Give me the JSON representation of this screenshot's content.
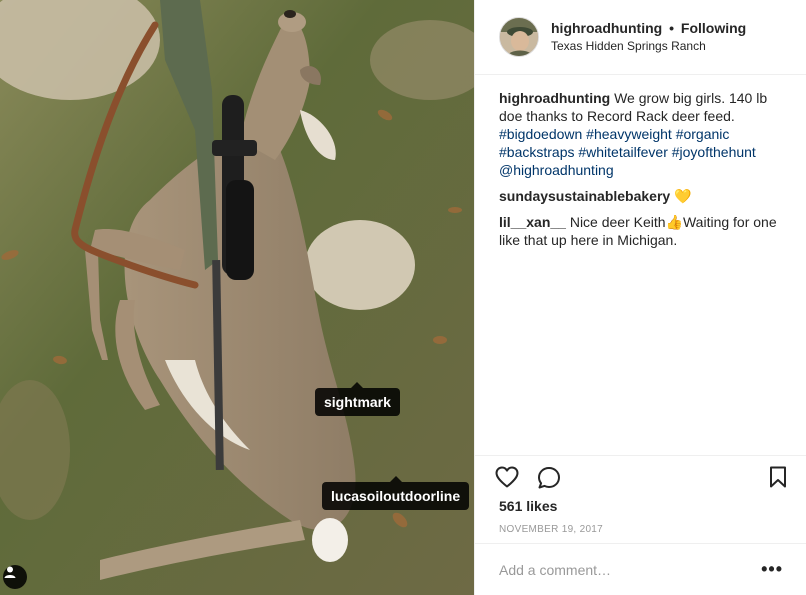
{
  "post": {
    "tags": {
      "sightmark": "sightmark",
      "lucas": "lucasoiloutdoorline"
    }
  },
  "header": {
    "username": "highroadhunting",
    "separator": "•",
    "follow_status": "Following",
    "location": "Texas Hidden Springs Ranch"
  },
  "caption": {
    "username": "highroadhunting",
    "text": "We grow big girls. 140 lb doe thanks to Record Rack deer feed.",
    "hashtags": "#bigdoedown #heavyweight #organic #backstraps #whitetailfever #joyofthehunt",
    "mention": "@highroadhunting"
  },
  "comments": [
    {
      "username": "sundaysustainablebakery",
      "text": "💛"
    },
    {
      "username": "lil__xan__",
      "text": "Nice deer Keith👍Waiting for one like that up here in Michigan."
    }
  ],
  "likes": "561 likes",
  "date": "NOVEMBER 19, 2017",
  "add_comment": {
    "placeholder": "Add a comment…"
  },
  "more_label": "•••",
  "icons": {
    "heart": "heart-icon",
    "comment": "comment-icon",
    "bookmark": "bookmark-icon",
    "more": "more-options-icon",
    "user_tag": "user-tag-icon"
  }
}
